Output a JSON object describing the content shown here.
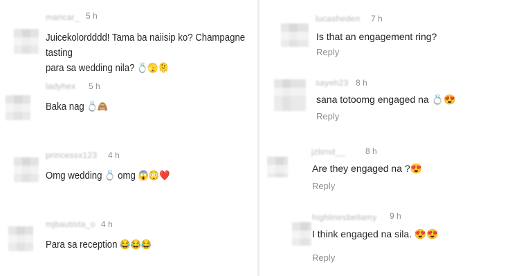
{
  "comments_left": [
    {
      "username": "maricar_",
      "time": "5 h",
      "text_line1": "Juicekolordddd! Tama ba naiisip ko? Champagne tasting",
      "text_line2": "para sa wedding nila?",
      "emojis": "💍🫣🫠"
    },
    {
      "username": "ladyhex",
      "time": "5 h",
      "text": "Baka nag",
      "emojis": "💍🙈"
    },
    {
      "username": "princessx123",
      "time": "4 h",
      "text": "Omg wedding",
      "emoji_mid": "💍",
      "text_after": "omg",
      "emojis": "😱😳❤️"
    },
    {
      "username": "mjbautista_o",
      "time": "4 h",
      "text": "Para sa reception",
      "emojis": "😂😂😂"
    }
  ],
  "comments_right": [
    {
      "username": "lucasheden",
      "time": "7 h",
      "text": "Is that an engagement ring?",
      "reply": "Reply"
    },
    {
      "username": "sayeh23",
      "time": "8 h",
      "text": "sana totoomg engaged na",
      "emojis": "💍😍",
      "reply": "Reply"
    },
    {
      "username": "jzbrnd__",
      "time": "8 h",
      "text": "Are they engaged na ?",
      "emojis": "😍",
      "reply": "Reply"
    },
    {
      "username": "highlinesbellamy",
      "time": "9 h",
      "text": "I think engaged na sila.",
      "emojis": "😍😍",
      "reply": "Reply"
    }
  ]
}
